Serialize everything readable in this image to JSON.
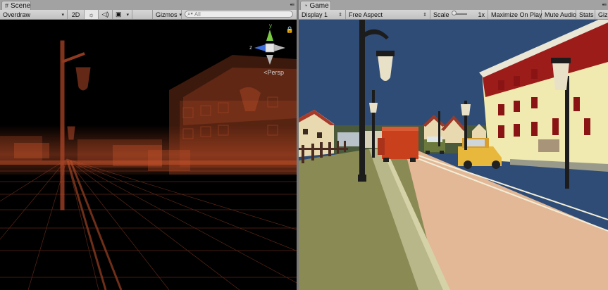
{
  "scene": {
    "tab_icon": "grid-icon",
    "tab_label": "Scene",
    "draw_mode": "Overdraw",
    "mode_2d": "2D",
    "gizmos_label": "Gizmos",
    "search_placeholder": "All",
    "gizmo_y": "y",
    "gizmo_z": "z",
    "persp_label": "Persp",
    "persp_glyph": "<",
    "lock_glyph": "🔒"
  },
  "game": {
    "tab_icon": "pacman-icon",
    "tab_label": "Game",
    "display": "Display 1",
    "aspect": "Free Aspect",
    "scale_label": "Scale",
    "scale_value": "1x",
    "maximize_label": "Maximize On Play",
    "mute_label": "Mute Audio",
    "stats_label": "Stats",
    "gizmos_label": "Gizmos"
  },
  "colors": {
    "overdraw": "#c8522a",
    "sky": "#2f4c76",
    "road": "#e2b896",
    "grass": "#8a8a54",
    "building_top": "#9c1c1a",
    "building_bottom": "#f0eab0",
    "truck": "#c9401c",
    "car": "#e8b83c"
  }
}
